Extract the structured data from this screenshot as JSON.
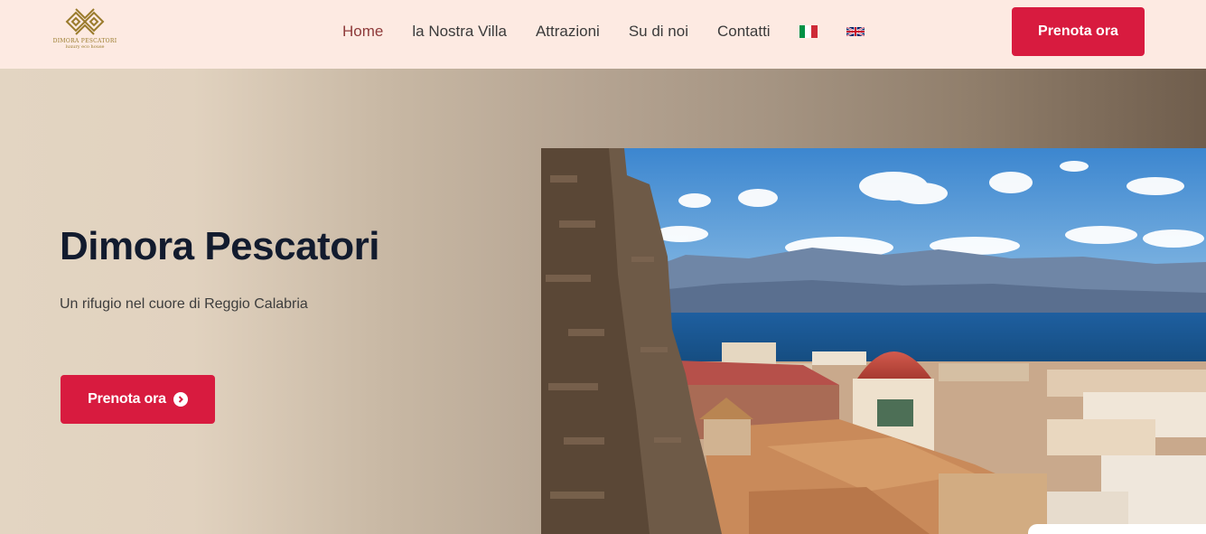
{
  "brand": {
    "logo_name": "DIMORA PESCATORI",
    "logo_tagline": "luxury eco house",
    "gold": "#9a7b2c"
  },
  "nav": {
    "items": [
      {
        "label": "Home",
        "active": true
      },
      {
        "label": "la Nostra Villa",
        "active": false
      },
      {
        "label": "Attrazioni",
        "active": false
      },
      {
        "label": "Su di noi",
        "active": false
      },
      {
        "label": "Contatti",
        "active": false
      }
    ],
    "languages": [
      "italian-flag-icon",
      "uk-flag-icon"
    ]
  },
  "header": {
    "cta_label": "Prenota ora"
  },
  "hero": {
    "title": "Dimora Pescatori",
    "subtitle": "Un rifugio nel cuore di Reggio Calabria",
    "cta_label": "Prenota ora",
    "cta_icon": "chevron-circle-right-icon",
    "image": "reggio-calabria-panorama"
  },
  "colors": {
    "header_bg": "#fdeae2",
    "accent": "#d81b3f",
    "title": "#121b2e",
    "nav_active": "#8e3a3a"
  }
}
